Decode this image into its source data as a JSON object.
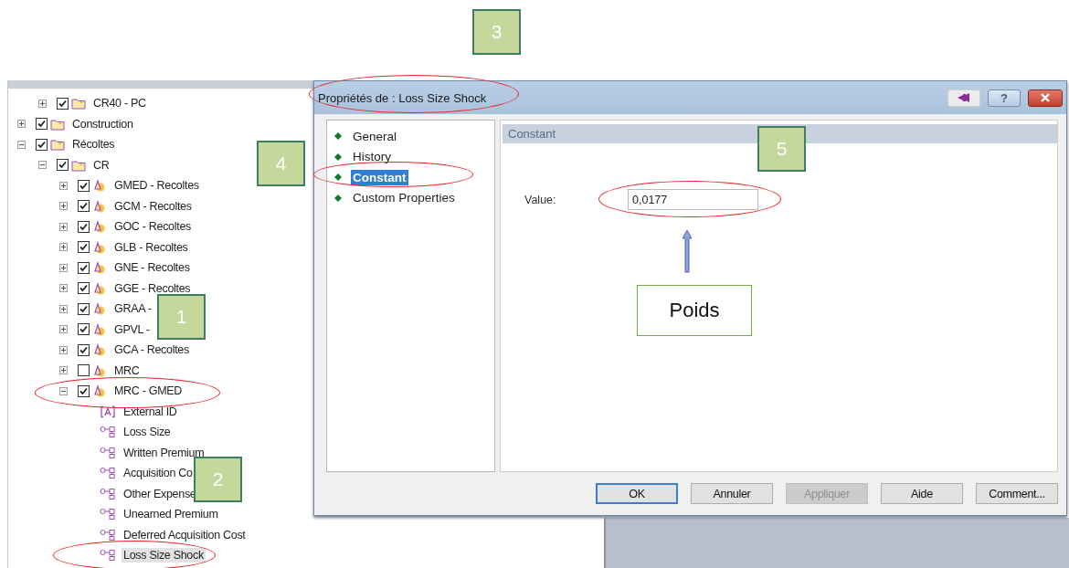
{
  "tree": {
    "continued_items": [
      {
        "label": "CR40 - PC",
        "kind": "folder",
        "checked": true,
        "expanded": false,
        "selected": false
      }
    ],
    "items": [
      {
        "label": "Construction",
        "kind": "folder",
        "checked": true,
        "expanded": false,
        "selected": false
      },
      {
        "label": "Récoltes",
        "kind": "folder",
        "checked": true,
        "expanded": true,
        "selected": false,
        "children": [
          {
            "label": "CR",
            "kind": "folder",
            "checked": true,
            "expanded": true,
            "selected": false,
            "children": [
              {
                "label": "GMED - Recoltes",
                "kind": "model",
                "checked": true,
                "expanded": false,
                "selected": false
              },
              {
                "label": "GCM - Recoltes",
                "kind": "model",
                "checked": true,
                "expanded": false,
                "selected": false
              },
              {
                "label": "GOC - Recoltes",
                "kind": "model",
                "checked": true,
                "expanded": false,
                "selected": false
              },
              {
                "label": "GLB - Recoltes",
                "kind": "model",
                "checked": true,
                "expanded": false,
                "selected": false
              },
              {
                "label": "GNE - Recoltes",
                "kind": "model",
                "checked": true,
                "expanded": false,
                "selected": false
              },
              {
                "label": "GGE - Recoltes",
                "kind": "model",
                "checked": true,
                "expanded": false,
                "selected": false
              },
              {
                "label": "GRAA -",
                "kind": "model",
                "checked": true,
                "expanded": false,
                "selected": false
              },
              {
                "label": "GPVL -",
                "kind": "model",
                "checked": true,
                "expanded": false,
                "selected": false
              },
              {
                "label": "GCA - Recoltes",
                "kind": "model",
                "checked": true,
                "expanded": false,
                "selected": false
              },
              {
                "label": "MRC",
                "kind": "model",
                "checked": false,
                "expanded": false,
                "selected": false
              },
              {
                "label": "MRC - GMED",
                "kind": "model",
                "checked": true,
                "expanded": true,
                "selected": false,
                "children": [
                  {
                    "label": "External ID",
                    "kind": "id",
                    "selected": false
                  },
                  {
                    "label": "Loss Size",
                    "kind": "variable",
                    "selected": false
                  },
                  {
                    "label": "Written Premium",
                    "kind": "variable",
                    "selected": false
                  },
                  {
                    "label": "Acquisition Co",
                    "kind": "variable",
                    "selected": false
                  },
                  {
                    "label": "Other Expense",
                    "kind": "variable",
                    "selected": false
                  },
                  {
                    "label": "Unearned Premium",
                    "kind": "variable",
                    "selected": false
                  },
                  {
                    "label": "Deferred Acquisition Cost",
                    "kind": "variable",
                    "selected": false
                  },
                  {
                    "label": "Loss Size Shock",
                    "kind": "variable",
                    "selected": true
                  }
                ]
              }
            ]
          }
        ]
      }
    ]
  },
  "dialog": {
    "title": "Propriétés de : Loss Size Shock",
    "help_button": "?",
    "nav": [
      {
        "label": "General",
        "selected": false
      },
      {
        "label": "History",
        "selected": false
      },
      {
        "label": "Constant",
        "selected": true
      },
      {
        "label": "Custom Properties",
        "selected": false
      }
    ],
    "section_title": "Constant",
    "field": {
      "label": "Value:",
      "value": "0,0177"
    },
    "buttons": [
      {
        "label": "OK",
        "default": true,
        "disabled": false
      },
      {
        "label": "Annuler",
        "default": false,
        "disabled": false
      },
      {
        "label": "Appliquer",
        "default": false,
        "disabled": true
      },
      {
        "label": "Aide",
        "default": false,
        "disabled": false
      },
      {
        "label": "Comment...",
        "default": false,
        "disabled": false
      }
    ]
  },
  "annotations": {
    "badges": [
      "3",
      "4",
      "5",
      "1",
      "2"
    ],
    "callout": "Poids"
  }
}
